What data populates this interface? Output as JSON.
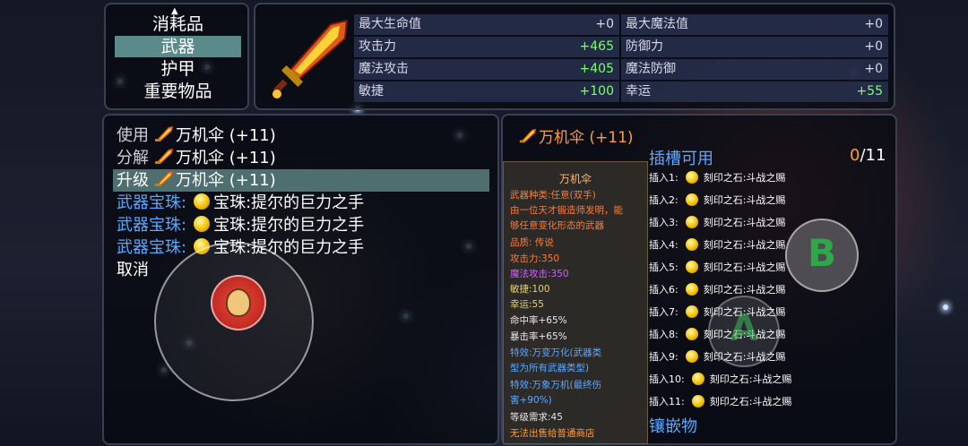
{
  "category_menu": {
    "items": [
      {
        "label": "消耗品",
        "selected": false
      },
      {
        "label": "武器",
        "selected": true
      },
      {
        "label": "护甲",
        "selected": false
      },
      {
        "label": "重要物品",
        "selected": false
      }
    ]
  },
  "stats": {
    "left": [
      {
        "label": "最大生命值",
        "value": "+0",
        "highlight": false
      },
      {
        "label": "攻击力",
        "value": "+465",
        "highlight": true
      },
      {
        "label": "魔法攻击",
        "value": "+405",
        "highlight": true
      },
      {
        "label": "敏捷",
        "value": "+100",
        "highlight": true
      }
    ],
    "right": [
      {
        "label": "最大魔法值",
        "value": "+0",
        "highlight": false
      },
      {
        "label": "防御力",
        "value": "+0",
        "highlight": false
      },
      {
        "label": "魔法防御",
        "value": "+0",
        "highlight": false
      },
      {
        "label": "幸运",
        "value": "+55",
        "highlight": true
      }
    ]
  },
  "actions": [
    {
      "label": "使用",
      "item": "万机伞 (+11)",
      "icon": "sword-icon"
    },
    {
      "label": "分解",
      "item": "万机伞 (+11)",
      "icon": "sword-icon"
    },
    {
      "label": "升级",
      "item": "万机伞 (+11)",
      "icon": "sword-icon",
      "selected": true
    },
    {
      "label": "武器宝珠:",
      "item": "宝珠:提尔的巨力之手",
      "icon": "orb-icon"
    },
    {
      "label": "武器宝珠:",
      "item": "宝珠:提尔的巨力之手",
      "icon": "orb-icon"
    },
    {
      "label": "武器宝珠:",
      "item": "宝珠:提尔的巨力之手",
      "icon": "orb-icon"
    },
    {
      "label": "取消"
    }
  ],
  "detail": {
    "title": "万机伞 (+11)",
    "card": {
      "name": "万机伞",
      "desc": [
        "武器种类:任意(双手)",
        "由一位天才锻造师发明，能",
        "够任意变化形态的武器"
      ],
      "grade": "品质: 传说",
      "atk": "攻击力:350",
      "matk": "魔法攻击:350",
      "agi": "敏捷:100",
      "luck": "幸运:55",
      "hit": "命中率+65%",
      "crit": "暴击率+65%",
      "effect1": [
        "特效:万变万化(武器类",
        "型为所有武器类型)"
      ],
      "effect2": [
        "特效:万象万机(最终伤",
        "害+90%)"
      ],
      "level": "等级需求:45",
      "note": "无法出售给普通商店"
    },
    "slot_header": "插槽可用",
    "slot_count_used": "0",
    "slot_count_total": "/11",
    "slots": [
      {
        "label": "插入1:",
        "item": "刻印之石:斗战之赐"
      },
      {
        "label": "插入2:",
        "item": "刻印之石:斗战之赐"
      },
      {
        "label": "插入3:",
        "item": "刻印之石:斗战之赐"
      },
      {
        "label": "插入4:",
        "item": "刻印之石:斗战之赐"
      },
      {
        "label": "插入5:",
        "item": "刻印之石:斗战之赐"
      },
      {
        "label": "插入6:",
        "item": "刻印之石:斗战之赐"
      },
      {
        "label": "插入7:",
        "item": "刻印之石:斗战之赐"
      },
      {
        "label": "插入8:",
        "item": "刻印之石:斗战之赐"
      },
      {
        "label": "插入9:",
        "item": "刻印之石:斗战之赐"
      },
      {
        "label": "插入10:",
        "item": "刻印之石:斗战之赐"
      },
      {
        "label": "插入11:",
        "item": "刻印之石:斗战之赐"
      }
    ],
    "inlay_label": "镶嵌物"
  },
  "buttons": {
    "b": "B",
    "a": "A"
  }
}
